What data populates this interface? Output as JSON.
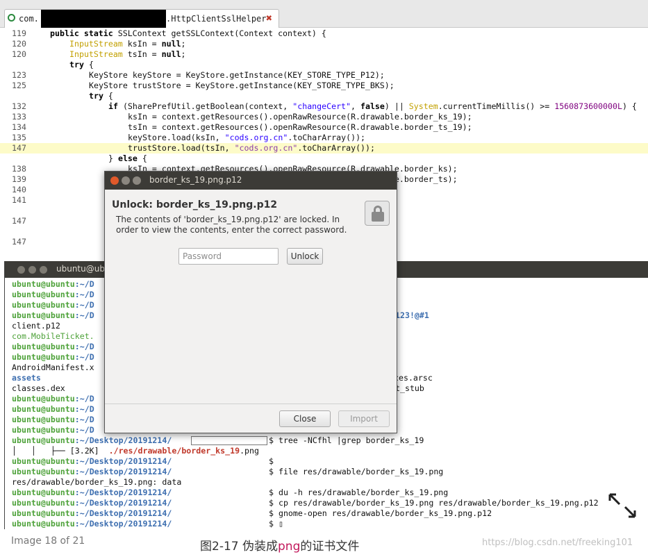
{
  "editor": {
    "tab": {
      "package_prefix": "com.",
      "file_name": ".HttpClientSslHelper",
      "close_glyph": "✖"
    },
    "lines": [
      {
        "num": "119",
        "indent": 0,
        "hl": false,
        "html": "<span class=\"kw\">public static</span> SSLContext getSSLContext(Context context) {"
      },
      {
        "num": "120",
        "indent": 1,
        "hl": false,
        "html": "<span class=\"ty\">InputStream</span> ksIn = <span class=\"kw\">null</span>;"
      },
      {
        "num": "120",
        "indent": 1,
        "hl": false,
        "html": "<span class=\"ty\">InputStream</span> tsIn = <span class=\"kw\">null</span>;"
      },
      {
        "num": "",
        "indent": 1,
        "hl": false,
        "html": "<span class=\"kw\">try</span> {"
      },
      {
        "num": "123",
        "indent": 2,
        "hl": false,
        "html": "KeyStore keyStore = KeyStore.getInstance(KEY_STORE_TYPE_P12);"
      },
      {
        "num": "125",
        "indent": 2,
        "hl": false,
        "html": "KeyStore trustStore = KeyStore.getInstance(KEY_STORE_TYPE_BKS);"
      },
      {
        "num": "",
        "indent": 2,
        "hl": false,
        "html": "<span class=\"kw\">try</span> {"
      },
      {
        "num": "132",
        "indent": 3,
        "hl": false,
        "html": "<span class=\"kw\">if</span> (SharePrefUtil.getBoolean(context, <span class=\"str\">\"changeCert\"</span>, <span class=\"kw\">false</span>) || <span class=\"ty\">System</span>.currentTimeMillis() >= <span class=\"num\">1560873600000L</span>) {"
      },
      {
        "num": "133",
        "indent": 4,
        "hl": false,
        "html": "ksIn = context.getResources().openRawResource(R.drawable.border_ks_19);"
      },
      {
        "num": "134",
        "indent": 4,
        "hl": false,
        "html": "tsIn = context.getResources().openRawResource(R.drawable.border_ts_19);"
      },
      {
        "num": "135",
        "indent": 4,
        "hl": false,
        "html": "keyStore.load(ksIn, <span class=\"str\">\"cods.org.cn\"</span>.toCharArray());"
      },
      {
        "num": "147",
        "indent": 4,
        "hl": true,
        "html": "trustStore.load(tsIn, <span class=\"str\">\"cods.org.cn\"</span>.toCharArray());"
      },
      {
        "num": "",
        "indent": 3,
        "hl": false,
        "html": "} <span class=\"kw\">else</span> {"
      },
      {
        "num": "138",
        "indent": 4,
        "hl": false,
        "html": "ksIn = context.getResources().openRawResource(R.drawable.border_ks);"
      },
      {
        "num": "139",
        "indent": 4,
        "hl": false,
        "html": "tsIn = context.getResources().openRawResource(R.drawable.border_ts);"
      },
      {
        "num": "140",
        "indent": 4,
        "hl": false,
        "html": ""
      },
      {
        "num": "141",
        "indent": 4,
        "hl": false,
        "html": ""
      },
      {
        "num": "",
        "indent": 4,
        "hl": false,
        "html": ""
      },
      {
        "num": "147",
        "indent": 4,
        "hl": false,
        "html": ""
      },
      {
        "num": "",
        "indent": 4,
        "hl": false,
        "html": ""
      },
      {
        "num": "147",
        "indent": 4,
        "hl": false,
        "html": ""
      }
    ]
  },
  "terminal": {
    "title": "ubuntu@ub",
    "user": "ubuntu@ubuntu",
    "lines": [
      {
        "t": "prompt",
        "path": ":~/D"
      },
      {
        "t": "prompt",
        "path": ":~/D"
      },
      {
        "t": "prompt",
        "path": ":~/D"
      },
      {
        "t": "prompt",
        "path": ":~/D",
        "right": "123!@#1",
        "right_class": "dir"
      },
      {
        "t": "out",
        "text": "client.p12",
        "cls": "out"
      },
      {
        "t": "out",
        "text": "com.MobileTicket.",
        "cls": "grn"
      },
      {
        "t": "prompt",
        "path": ":~/D"
      },
      {
        "t": "prompt",
        "path": ":~/D"
      },
      {
        "t": "out",
        "text": "AndroidManifest.x",
        "cls": "out"
      },
      {
        "t": "out",
        "text": "assets",
        "cls": "dir",
        "right": "ces.arsc",
        "right_class": "out"
      },
      {
        "t": "out",
        "text": "classes.dex",
        "cls": "out",
        "right": "t_stub",
        "right_class": "out"
      },
      {
        "t": "prompt",
        "path": ":~/D"
      },
      {
        "t": "prompt",
        "path": ":~/D"
      },
      {
        "t": "prompt",
        "path": ":~/D"
      },
      {
        "t": "prompt",
        "path": ":~/D"
      },
      {
        "t": "prompt",
        "path": ":~/Desktop/20191214/",
        "redact": true,
        "cmd": "$ tree -NCfhl |grep border_ks_19"
      },
      {
        "t": "tree",
        "prefix": "│   │   ├── [3.2K]  ",
        "path_a": "./res/drawable/",
        "path_b": "border_ks_19",
        "path_c": ".png"
      },
      {
        "t": "prompt",
        "path": ":~/Desktop/20191214/",
        "cmd": "$"
      },
      {
        "t": "prompt",
        "path": ":~/Desktop/20191214/",
        "redact_short": true,
        "cmd": "$ file res/drawable/border_ks_19.png"
      },
      {
        "t": "out",
        "text": "res/drawable/border_ks_19.png: data",
        "cls": "out"
      },
      {
        "t": "prompt",
        "path": ":~/Desktop/20191214/",
        "cmd": "$ du -h res/drawable/border_ks_19.png"
      },
      {
        "t": "prompt",
        "path": ":~/Desktop/20191214/",
        "cmd": "$ cp res/drawable/border_ks_19.png res/drawable/border_ks_19.png.p12"
      },
      {
        "t": "prompt",
        "path": ":~/Desktop/20191214/",
        "cmd": "$ gnome-open res/drawable/border_ks_19.png.p12"
      },
      {
        "t": "prompt",
        "path": ":~/Desktop/20191214/",
        "cmd": "$ ▯"
      }
    ]
  },
  "dialog": {
    "title": "border_ks_19.png.p12",
    "heading": "Unlock: border_ks_19.png.p12",
    "message": "The contents of 'border_ks_19.png.p12' are locked. In order to view the contents, enter the correct password.",
    "password_placeholder": "Password",
    "unlock_label": "Unlock",
    "close_label": "Close",
    "import_label": "Import"
  },
  "viewer": {
    "counter": "Image 18 of 21",
    "caption_a": "图2-17 伪装成",
    "caption_b": "png",
    "caption_c": "的证书文件",
    "watermark": "https://blog.csdn.net/freeking101"
  },
  "colors": {
    "terminal_user": "#4ea23a",
    "terminal_path": "#3e6fb0",
    "highlight_line": "#fdfbc8",
    "window_titlebar": "#3c3b37",
    "close_dot": "#e0592a"
  }
}
